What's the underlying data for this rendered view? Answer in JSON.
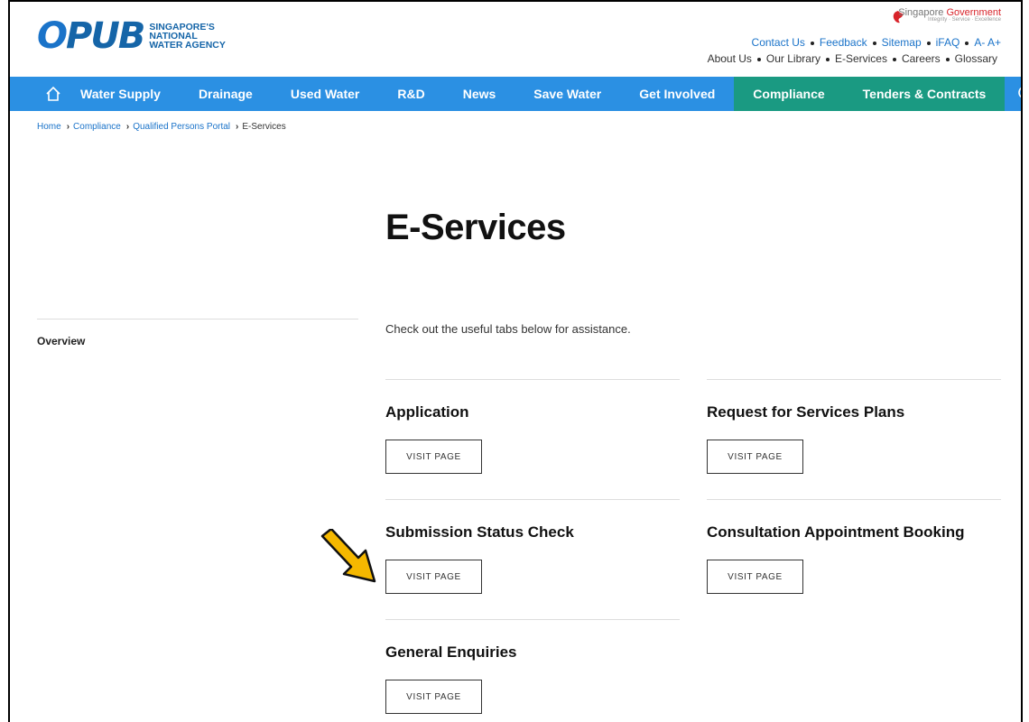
{
  "logo": {
    "mark": "PUB",
    "line1": "SINGAPORE'S",
    "line2": "NATIONAL",
    "line3": "WATER AGENCY"
  },
  "gov": {
    "name_a": "Singapore",
    "name_b": "Government",
    "tagline": "Integrity · Service · Excellence"
  },
  "utility_links": [
    "Contact Us",
    "Feedback",
    "Sitemap",
    "iFAQ",
    "A-",
    "A+"
  ],
  "secondary_links": [
    "About Us",
    "Our Library",
    "E-Services",
    "Careers",
    "Glossary"
  ],
  "nav": {
    "items": [
      "Water Supply",
      "Drainage",
      "Used Water",
      "R&D",
      "News",
      "Save Water",
      "Get Involved",
      "Compliance",
      "Tenders & Contracts"
    ]
  },
  "breadcrumb": [
    "Home",
    "Compliance",
    "Qualified Persons Portal",
    "E-Services"
  ],
  "page_title": "E-Services",
  "sidebar": {
    "title": "Overview"
  },
  "intro": "Check out the useful tabs below for assistance.",
  "cards": [
    {
      "title": "Application",
      "button": "VISIT PAGE"
    },
    {
      "title": "Request for Services Plans",
      "button": "VISIT PAGE"
    },
    {
      "title": "Submission Status Check",
      "button": "VISIT PAGE"
    },
    {
      "title": "Consultation Appointment Booking",
      "button": "VISIT PAGE"
    },
    {
      "title": "General Enquiries",
      "button": "VISIT PAGE"
    }
  ],
  "colors": {
    "nav": "#2b90e3",
    "nav_active": "#1a9a82",
    "link": "#1a73c9",
    "arrow": "#f5b800"
  }
}
